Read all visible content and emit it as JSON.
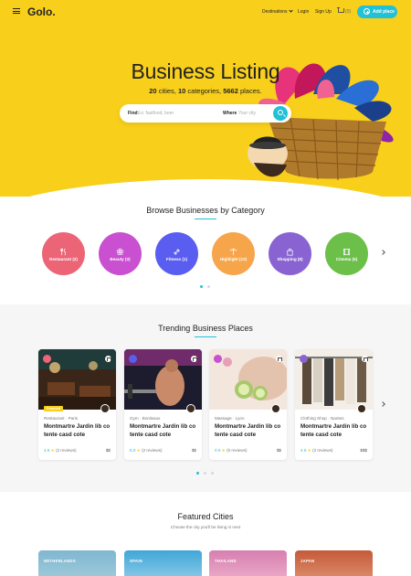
{
  "nav": {
    "logo": "Golo.",
    "destinations": "Destinations",
    "login": "Login",
    "signup": "Sign Up",
    "cart_count": "(0)",
    "add_place": "Add place"
  },
  "hero": {
    "title": "Business Listing",
    "sub_cities_num": "20",
    "sub_cities": "cities,",
    "sub_categories_num": "10",
    "sub_categories": "categories,",
    "sub_places_num": "5662",
    "sub_places": "places.",
    "find_label": "Find",
    "find_placeholder": "Ex: fastfood, beer",
    "where_label": "Where",
    "where_placeholder": "Your city"
  },
  "categories": {
    "title": "Browse Businesses by Category",
    "items": [
      {
        "label": "Restaurant (2)",
        "color": "#ec6577",
        "icon": "cutlery-icon"
      },
      {
        "label": "Beauty (3)",
        "color": "#c950d0",
        "icon": "flower-icon"
      },
      {
        "label": "Fitness (1)",
        "color": "#5a5ef0",
        "icon": "dumbbell-icon"
      },
      {
        "label": "Highlight (10)",
        "color": "#f7a54b",
        "icon": "palm-icon"
      },
      {
        "label": "Shopping (8)",
        "color": "#8a63d2",
        "icon": "bag-icon"
      },
      {
        "label": "Cinema (5)",
        "color": "#6cc04a",
        "icon": "film-icon"
      }
    ]
  },
  "trending": {
    "title": "Trending Business Places",
    "cards": [
      {
        "badge": "Featured",
        "category": "Restaurant",
        "city": "Paris",
        "name": "Montmartre Jardin lib co tente casd cote",
        "rating": "4.5",
        "reviews": "(2 reviews)",
        "price": "$$",
        "badge_color": "#ec6577"
      },
      {
        "badge": "",
        "category": "Gym",
        "city": "Bordeaux",
        "name": "Montmartre Jardin lib co tente casd cote",
        "rating": "5.0",
        "reviews": "(2 reviews)",
        "price": "$$",
        "badge_color": "#5a5ef0"
      },
      {
        "badge": "",
        "category": "Massage",
        "city": "Lyon",
        "name": "Montmartre Jardin lib co tente casd cote",
        "rating": "0.0",
        "reviews": "(0 reviews)",
        "price": "$$",
        "badge_color": "#c950d0"
      },
      {
        "badge": "",
        "category": "Clothing Shop",
        "city": "Nantes",
        "name": "Montmartre Jardin lib co tente casd cote",
        "rating": "4.5",
        "reviews": "(2 reviews)",
        "price": "$$$",
        "badge_color": "#8a63d2"
      }
    ]
  },
  "featured": {
    "title": "Featured Cities",
    "subtitle": "Choose the city you'll be living in next",
    "cities": [
      "NETHERLANDS",
      "SPAIN",
      "THAILAND",
      "JAPAN"
    ]
  }
}
